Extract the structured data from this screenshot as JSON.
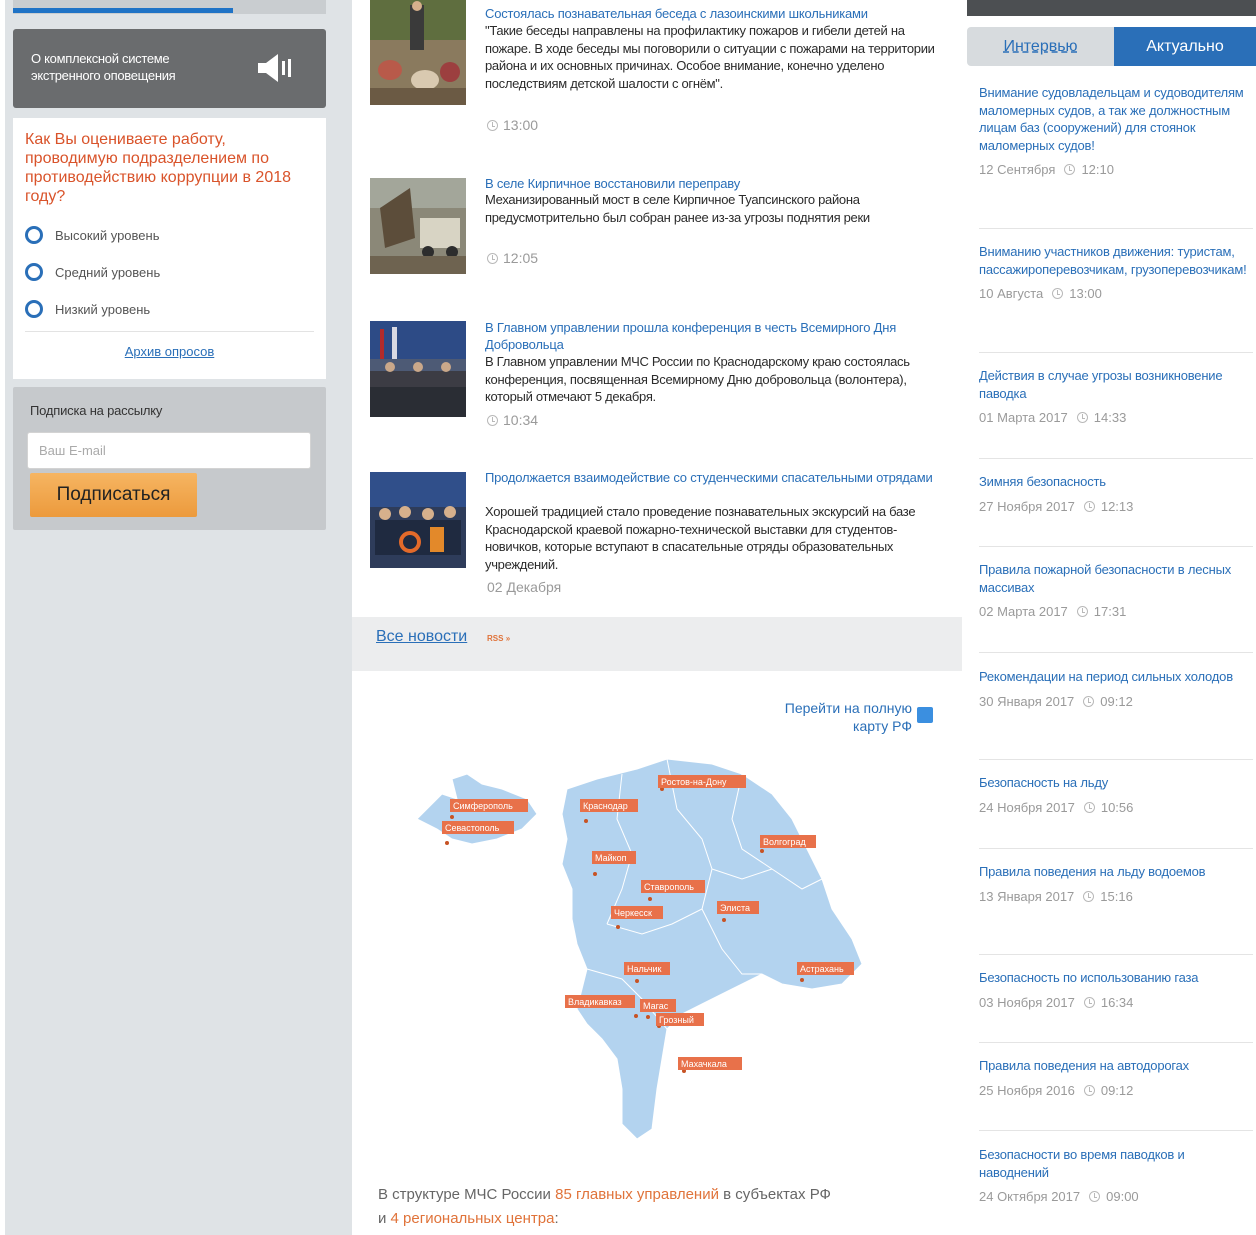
{
  "left": {
    "alert": {
      "text": "О комплексной системе экстренного оповещения"
    },
    "poll": {
      "question": "Как Вы оцениваете работу, проводимую подразделением по противодействию коррупции в 2018 году?",
      "options": [
        "Высокий уровень",
        "Средний уровень",
        "Низкий уровень"
      ],
      "archive_link": "Архив опросов"
    },
    "subscribe": {
      "title": "Подписка на рассылку",
      "placeholder": "Ваш E-mail",
      "button": "Подписаться"
    }
  },
  "news": {
    "items": [
      {
        "title": "Состоялась познавательная беседа с лазоинскими школьниками",
        "text": "\"Такие беседы направлены на профилактику пожаров и гибели детей на пожаре. В ходе беседы мы поговорили о ситуации с пожарами на территории района и их основных причинах. Особое внимание, конечно уделено последствиям детской шалости с огнём\".",
        "time": "13:00"
      },
      {
        "title": "В селе Кирпичное восстановили переправу",
        "text": "Механизированный мост в селе Кирпичное Туапсинского района предусмотрительно был собран ранее из-за угрозы поднятия реки",
        "time": "12:05"
      },
      {
        "title": "В Главном управлении прошла конференция в честь Всемирного Дня Добровольца",
        "text": "В Главном управлении МЧС России по Краснодарскому краю состоялась конференция, посвященная Всемирному Дню добровольца (волонтера), который отмечают 5 декабря.",
        "time": "10:34"
      },
      {
        "title": "Продолжается взаимодействие со студенческими спасательными отрядами",
        "text": "Хорошей традицией стало проведение познавательных экскурсий на базе Краснодарской краевой пожарно-технической выставки для студентов-новичков, которые вступают в спасательные отряды образовательных учреждений.",
        "time": "02 Декабря"
      }
    ],
    "all_news": "Все новости",
    "rss": "RSS"
  },
  "map": {
    "link": "Перейти на полную карту РФ",
    "cities": [
      "Симферополь",
      "Севастополь",
      "Краснодар",
      "Ростов-на-Дону",
      "Волгоград",
      "Майкоп",
      "Ставрополь",
      "Черкесск",
      "Элиста",
      "Нальчик",
      "Астрахань",
      "Владикавказ",
      "Магас",
      "Грозный",
      "Махачкала"
    ],
    "footer_1": "В структуре МЧС России ",
    "footer_2": "85 главных управлений",
    "footer_3": " в субъектах РФ",
    "footer_4": "и ",
    "footer_5": "4 региональных центра",
    "footer_6": ":"
  },
  "right": {
    "tabs": {
      "inactive": "Интервью",
      "active": "Актуально"
    },
    "items": [
      {
        "title": "Внимание судовладельцам и судоводителям маломерных судов, а так же должностным лицам баз (сооружений) для стоянок маломерных судов!",
        "date": "12 Сентября",
        "time": "12:10"
      },
      {
        "title": "Вниманию участников движения: туристам, пассажироперевозчикам, грузоперевозчикам!",
        "date": "10 Августа",
        "time": "13:00"
      },
      {
        "title": "Действия в случае угрозы возникновение паводка",
        "date": "01 Марта 2017",
        "time": "14:33"
      },
      {
        "title": "Зимняя безопасность",
        "date": "27 Ноября 2017",
        "time": "12:13"
      },
      {
        "title": "Правила пожарной безопасности в лесных массивах",
        "date": "02 Марта 2017",
        "time": "17:31"
      },
      {
        "title": "Рекомендации на период сильных холодов",
        "date": "30 Января 2017",
        "time": "09:12"
      },
      {
        "title": "Безопасность на льду",
        "date": "24 Ноября 2017",
        "time": "10:56"
      },
      {
        "title": "Правила поведения на льду водоемов",
        "date": "13 Января 2017",
        "time": "15:16"
      },
      {
        "title": "Безопасность по использованию газа",
        "date": "03 Ноября 2017",
        "time": "16:34"
      },
      {
        "title": "Правила поведения на автодорогах",
        "date": "25 Ноября 2016",
        "time": "09:12"
      },
      {
        "title": "Безопасности во время паводков и наводнений",
        "date": "24 Октября 2017",
        "time": "09:00"
      }
    ]
  }
}
